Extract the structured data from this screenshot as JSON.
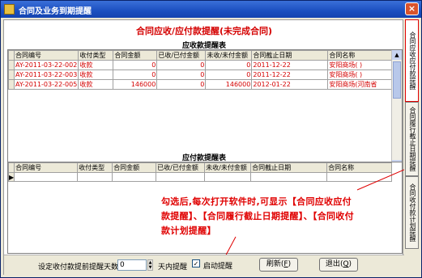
{
  "window": {
    "title": "合同及业务到期提醒",
    "close_label": "×"
  },
  "main_title": "合同应收/应付款提醒(未完成合同)",
  "receivable": {
    "title": "应收款提醒表",
    "columns": [
      "合同编号",
      "收付类型",
      "合同金额",
      "已收/已付金额",
      "未收/未付金额",
      "合同截止日期",
      "合同名称"
    ],
    "rows": [
      [
        "AY-2011-03-22-002",
        "收款",
        "0",
        "0",
        "0",
        "2011-12-22",
        "安阳商场( )"
      ],
      [
        "AY-2011-03-22-003",
        "收款",
        "0",
        "0",
        "0",
        "2011-12-22",
        "安阳商场( )"
      ],
      [
        "AY-2011-03-22-005",
        "收款",
        "146000",
        "0",
        "146000",
        "2012-01-22",
        "安阳商场(河南省"
      ]
    ]
  },
  "payable": {
    "title": "应付款提醒表",
    "columns": [
      "合同编号",
      "收付类型",
      "合同金额",
      "已收/已付金额",
      "未收/未付金额",
      "合同截止日期",
      "合同名称"
    ]
  },
  "annotation": "勾选后,每次打开软件时,可显示【合同应收应付款提醒】、【合同履行截止日期提醒】、【合同收付款计划提醒】",
  "bottom": {
    "days_label": "设定收付款提前提醒天数:",
    "days_value": "0",
    "days_suffix": "天内提醒",
    "startup_label": "启动提醒",
    "startup_checked": true,
    "refresh_label": "刷新",
    "refresh_key": "F",
    "exit_label": "退出",
    "exit_key": "Q"
  },
  "side_tabs": [
    "合同应收应付款提醒",
    "合同履行截止日期提醒",
    "合同收付款计划提醒"
  ]
}
